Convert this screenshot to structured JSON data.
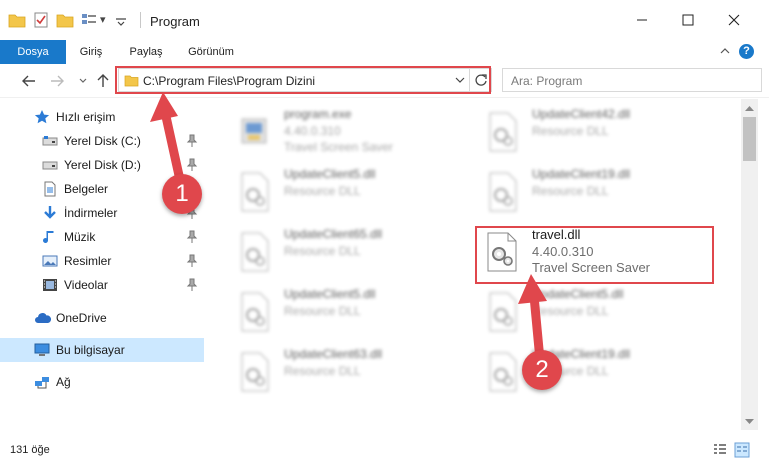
{
  "window": {
    "title": "Program",
    "quick_access_dropdown": "▾"
  },
  "ribbon": {
    "tabs": [
      {
        "label": "Dosya",
        "active": true
      },
      {
        "label": "Giriş",
        "active": false
      },
      {
        "label": "Paylaş",
        "active": false
      },
      {
        "label": "Görünüm",
        "active": false
      }
    ],
    "help_icon": "?"
  },
  "address": {
    "path": "C:\\Program Files\\Program Dizini",
    "search_placeholder": "Ara: Program"
  },
  "sidebar": {
    "items": [
      {
        "label": "Hızlı erişim",
        "icon": "star-icon",
        "pinned": false
      },
      {
        "label": "Yerel Disk (C:)",
        "icon": "drive-icon",
        "pinned": true
      },
      {
        "label": "Yerel Disk (D:)",
        "icon": "drive-icon",
        "pinned": true
      },
      {
        "label": "Belgeler",
        "icon": "documents-icon",
        "pinned": true
      },
      {
        "label": "İndirmeler",
        "icon": "download-icon",
        "pinned": true
      },
      {
        "label": "Müzik",
        "icon": "music-icon",
        "pinned": true
      },
      {
        "label": "Resimler",
        "icon": "pictures-icon",
        "pinned": true
      },
      {
        "label": "Videolar",
        "icon": "videos-icon",
        "pinned": true
      },
      {
        "label": "OneDrive",
        "icon": "cloud-icon",
        "pinned": false
      },
      {
        "label": "Bu bilgisayar",
        "icon": "computer-icon",
        "pinned": false,
        "selected": true
      },
      {
        "label": "Ağ",
        "icon": "network-icon",
        "pinned": false
      }
    ]
  },
  "files": [
    {
      "name": "program.exe",
      "version": "4.40.0.310",
      "description": "Travel Screen Saver"
    },
    {
      "name": "UpdateClient42.dll",
      "description": "Resource DLL"
    },
    {
      "name": "UpdateClient5.dll",
      "description": "Resource DLL"
    },
    {
      "name": "UpdateClient19.dll",
      "description": "Resource DLL"
    },
    {
      "name": "UpdateClient65.dll",
      "description": "Resource DLL"
    },
    {
      "name": "travel.dll",
      "version": "4.40.0.310",
      "description": "Travel Screen Saver"
    },
    {
      "name": "UpdateClient5.dll",
      "description": "Resource DLL"
    },
    {
      "name": "UpdateClient5.dll",
      "description": "Resource DLL"
    },
    {
      "name": "UpdateClient63.dll",
      "description": "Resource DLL"
    },
    {
      "name": "UpdateClient19.dll",
      "description": "Resource DLL"
    }
  ],
  "status": {
    "item_count": "131 öğe"
  },
  "annotations": {
    "step1": "1",
    "step2": "2",
    "color": "#e0474c"
  },
  "colors": {
    "accent": "#1979ca",
    "selection": "#cce8ff",
    "highlight": "#e0474c"
  }
}
